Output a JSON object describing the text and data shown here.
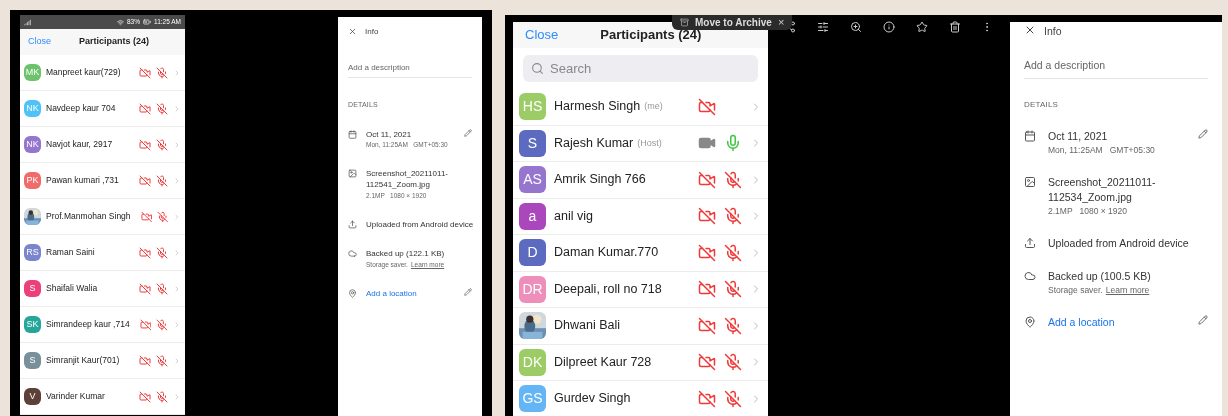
{
  "screenshots": [
    {
      "status_bar": {
        "battery": "83%",
        "time": "11:25 AM"
      },
      "participants": {
        "close": "Close",
        "title": "Participants (24)",
        "rows": [
          {
            "kind": "initials",
            "initials": "MK",
            "color": "#6cc36c",
            "name": "Manpreet kaur(729)",
            "video_on": false,
            "mic_on": false
          },
          {
            "kind": "initials",
            "initials": "NK",
            "color": "#4fc3f7",
            "name": "Navdeep kaur 704",
            "video_on": false,
            "mic_on": false
          },
          {
            "kind": "initials",
            "initials": "NK",
            "color": "#9575cd",
            "name": "Navjot kaur,  2917",
            "video_on": false,
            "mic_on": false
          },
          {
            "kind": "initials",
            "initials": "PK",
            "color": "#f26b6b",
            "name": "Pawan kumari ,731",
            "video_on": false,
            "mic_on": false
          },
          {
            "kind": "picture",
            "name": "Prof.Manmohan Singh",
            "video_on": false,
            "mic_on": false
          },
          {
            "kind": "initials",
            "initials": "RS",
            "color": "#7986cb",
            "name": "Raman Saini",
            "video_on": false,
            "mic_on": false
          },
          {
            "kind": "initials",
            "initials": "S",
            "color": "#ec407a",
            "name": "Shaifali Walia",
            "video_on": false,
            "mic_on": false
          },
          {
            "kind": "initials",
            "initials": "SK",
            "color": "#26a69a",
            "name": "Simrandeep kaur ,714",
            "video_on": false,
            "mic_on": false
          },
          {
            "kind": "initials",
            "initials": "S",
            "color": "#78909c",
            "name": "Simranjit Kaur(701)",
            "video_on": false,
            "mic_on": false
          },
          {
            "kind": "initials",
            "initials": "V",
            "color": "#5d4037",
            "name": "Varinder Kumar",
            "video_on": false,
            "mic_on": false
          }
        ]
      },
      "info": {
        "title": "Info",
        "description_placeholder": "Add a description",
        "details_heading": "DETAILS",
        "items": [
          {
            "kind": "date",
            "title": "Oct 11, 2021",
            "subtitle": "Mon, 11:25AM   GMT+05:30",
            "editable": true
          },
          {
            "kind": "file",
            "title": "Screenshot_20211011-112541_Zoom.jpg",
            "subtitle": "2.1MP   1080 × 1920"
          },
          {
            "kind": "upload",
            "title": "Uploaded from Android device"
          },
          {
            "kind": "backup",
            "title": "Backed up (122.1 KB)",
            "subtitle": "Storage saver.",
            "link": "Learn more"
          },
          {
            "kind": "location",
            "title": "Add a location",
            "editable": true
          }
        ]
      }
    },
    {
      "tooltip": {
        "label": "Move to Archive",
        "close": "×"
      },
      "participants": {
        "close": "Close",
        "title": "Participants (24)",
        "search_placeholder": "Search",
        "rows": [
          {
            "kind": "initials",
            "initials": "HS",
            "color": "#9ccc65",
            "name": "Harmesh Singh",
            "tag": "(me)",
            "video_on": false
          },
          {
            "kind": "initials",
            "initials": "S",
            "color": "#5c6bc0",
            "name": "Rajesh Kumar",
            "tag": "(Host)",
            "video_on": true,
            "mic_on": true
          },
          {
            "kind": "initials",
            "initials": "AS",
            "color": "#9575cd",
            "name": "Amrik Singh 766",
            "video_on": false,
            "mic_on": false
          },
          {
            "kind": "initials",
            "initials": "a",
            "color": "#ab47bc",
            "name": "anil vig",
            "video_on": false,
            "mic_on": false
          },
          {
            "kind": "initials",
            "initials": "D",
            "color": "#5c6bc0",
            "name": "Daman Kumar.770",
            "video_on": false,
            "mic_on": false
          },
          {
            "kind": "initials",
            "initials": "DR",
            "color": "#ee8fbb",
            "name": "Deepali, roll no 718",
            "video_on": false,
            "mic_on": false
          },
          {
            "kind": "picture",
            "name": "Dhwani Bali",
            "video_on": false,
            "mic_on": false
          },
          {
            "kind": "initials",
            "initials": "DK",
            "color": "#9ccc65",
            "name": "Dilpreet Kaur 728",
            "video_on": false,
            "mic_on": false
          },
          {
            "kind": "initials",
            "initials": "GS",
            "color": "#64b5f6",
            "name": "Gurdev Singh",
            "video_on": false,
            "mic_on": false
          }
        ]
      },
      "info": {
        "title": "Info",
        "description_placeholder": "Add a description",
        "details_heading": "DETAILS",
        "items": [
          {
            "kind": "date",
            "title": "Oct 11, 2021",
            "subtitle": "Mon, 11:25AM   GMT+05:30",
            "editable": true
          },
          {
            "kind": "file",
            "title": "Screenshot_20211011-112534_Zoom.jpg",
            "subtitle": "2.1MP   1080 × 1920"
          },
          {
            "kind": "upload",
            "title": "Uploaded from Android device"
          },
          {
            "kind": "backup",
            "title": "Backed up (100.5 KB)",
            "subtitle": "Storage saver.",
            "link": "Learn more"
          },
          {
            "kind": "location",
            "title": "Add a location",
            "editable": true
          }
        ]
      }
    }
  ]
}
